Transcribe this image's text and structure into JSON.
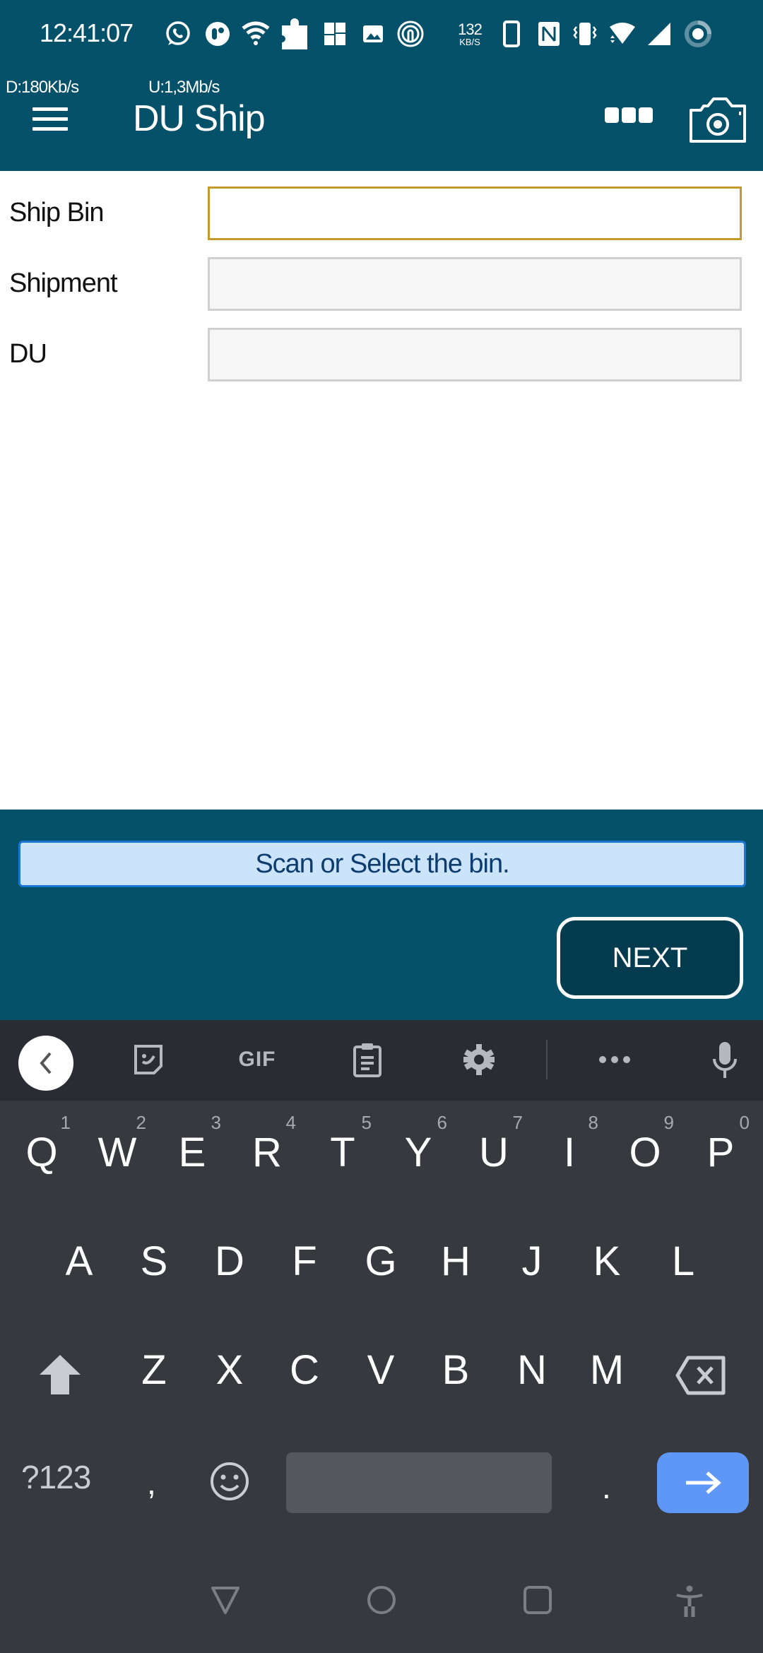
{
  "status_bar": {
    "time": "12:41:07",
    "net_speed_value": "132",
    "net_speed_unit": "KB/S",
    "left_icons": [
      "whatsapp-icon",
      "notification-app-icon",
      "wifi-icon",
      "puzzle-icon",
      "photo-collage-icon",
      "image-icon",
      "life360-icon"
    ],
    "right_icons": [
      "phone-outline-icon",
      "nfc-icon",
      "vibrate-icon",
      "wifi-signal-icon",
      "cell-signal-icon",
      "battery-ring-icon"
    ]
  },
  "app_header": {
    "download_speed": "D:180Kb/s",
    "upload_speed": "U:1,3Mb/s",
    "title": "DU Ship",
    "menu_icon": "hamburger-menu-icon",
    "more_icon": "more-options-icon",
    "camera_icon": "camera-icon"
  },
  "form": {
    "fields": [
      {
        "label": "Ship Bin",
        "value": "",
        "placeholder": "",
        "focused": true
      },
      {
        "label": "Shipment",
        "value": "",
        "placeholder": "",
        "focused": false
      },
      {
        "label": "DU",
        "value": "",
        "placeholder": "",
        "focused": false
      }
    ]
  },
  "footer": {
    "message": "Scan or Select the bin.",
    "next_label": "NEXT"
  },
  "keyboard": {
    "toolbar": {
      "gif_label": "GIF",
      "icons": [
        "collapse-chevron-icon",
        "sticker-icon",
        "gif-icon",
        "clipboard-icon",
        "settings-gear-icon",
        "more-dots-icon",
        "microphone-icon"
      ]
    },
    "row1": [
      {
        "key": "Q",
        "hint": "1"
      },
      {
        "key": "W",
        "hint": "2"
      },
      {
        "key": "E",
        "hint": "3"
      },
      {
        "key": "R",
        "hint": "4"
      },
      {
        "key": "T",
        "hint": "5"
      },
      {
        "key": "Y",
        "hint": "6"
      },
      {
        "key": "U",
        "hint": "7"
      },
      {
        "key": "I",
        "hint": "8"
      },
      {
        "key": "O",
        "hint": "9"
      },
      {
        "key": "P",
        "hint": "0"
      }
    ],
    "row2": [
      "A",
      "S",
      "D",
      "F",
      "G",
      "H",
      "J",
      "K",
      "L"
    ],
    "row3": [
      "Z",
      "X",
      "C",
      "V",
      "B",
      "N",
      "M"
    ],
    "symbols_label": "?123",
    "comma": ",",
    "period": "."
  },
  "colors": {
    "header_bg": "#05516a",
    "focus_border": "#c49a2c",
    "message_bg": "#cce4fa",
    "message_border": "#1976d2",
    "enter_key": "#5e97f6",
    "keyboard_bg": "#363a3f"
  }
}
